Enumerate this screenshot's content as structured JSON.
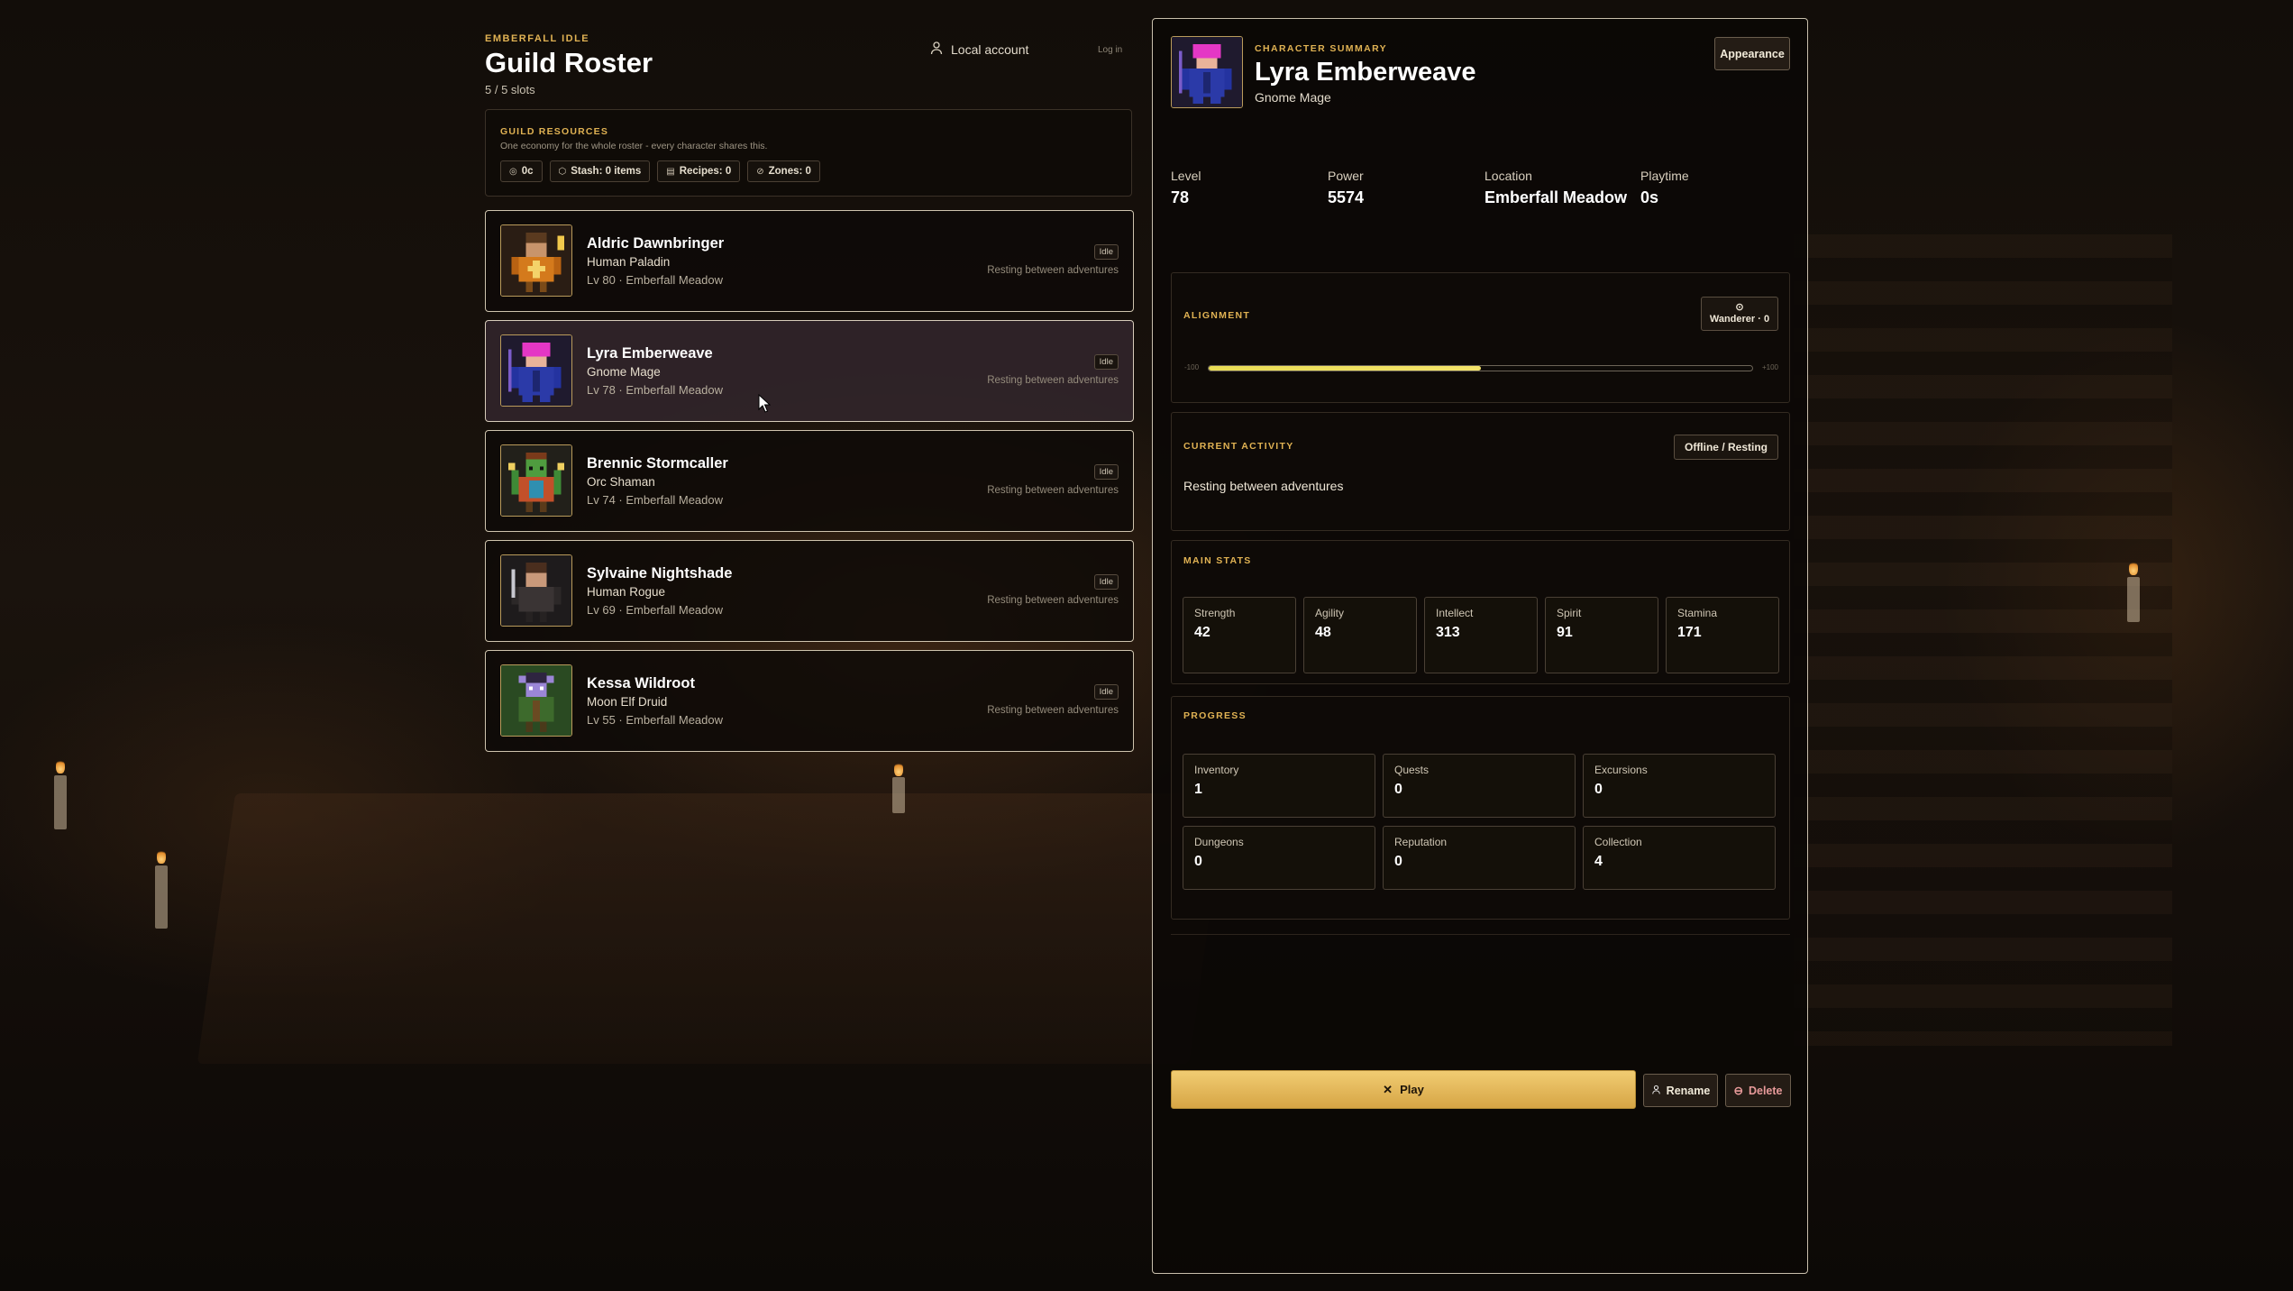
{
  "app": {
    "brand": "EMBERFALL IDLE",
    "title": "Guild Roster",
    "slots": "5 / 5 slots"
  },
  "account": {
    "label": "Local account",
    "login": "Log in"
  },
  "resources": {
    "title": "GUILD RESOURCES",
    "subtitle": "One economy for the whole roster - every character shares this.",
    "chips": [
      {
        "icon": "coin-icon",
        "label": "0c"
      },
      {
        "icon": "box-icon",
        "label": "Stash: 0 items"
      },
      {
        "icon": "scroll-icon",
        "label": "Recipes: 0"
      },
      {
        "icon": "compass-icon",
        "label": "Zones: 0"
      }
    ]
  },
  "roster": [
    {
      "name": "Aldric Dawnbringer",
      "class": "Human Paladin",
      "meta": "Lv 80 · Emberfall Meadow",
      "badge": "Idle",
      "status": "Resting between adventures",
      "selected": false
    },
    {
      "name": "Lyra Emberweave",
      "class": "Gnome Mage",
      "meta": "Lv 78 · Emberfall Meadow",
      "badge": "Idle",
      "status": "Resting between adventures",
      "selected": true
    },
    {
      "name": "Brennic Stormcaller",
      "class": "Orc Shaman",
      "meta": "Lv 74 · Emberfall Meadow",
      "badge": "Idle",
      "status": "Resting between adventures",
      "selected": false
    },
    {
      "name": "Sylvaine Nightshade",
      "class": "Human Rogue",
      "meta": "Lv 69 · Emberfall Meadow",
      "badge": "Idle",
      "status": "Resting between adventures",
      "selected": false
    },
    {
      "name": "Kessa Wildroot",
      "class": "Moon Elf Druid",
      "meta": "Lv 55 · Emberfall Meadow",
      "badge": "Idle",
      "status": "Resting between adventures",
      "selected": false
    }
  ],
  "summary": {
    "eyebrow": "CHARACTER SUMMARY",
    "name": "Lyra Emberweave",
    "class": "Gnome Mage",
    "appearance_label": "Appearance",
    "overview": [
      {
        "label": "Level",
        "value": "78"
      },
      {
        "label": "Power",
        "value": "5574"
      },
      {
        "label": "Location",
        "value": "Emberfall Meadow"
      },
      {
        "label": "Playtime",
        "value": "0s"
      }
    ],
    "alignment": {
      "title": "ALIGNMENT",
      "badge_icon": "compass-icon",
      "badge": "Wanderer · 0",
      "min": "-100",
      "max": "+100",
      "value": 0,
      "fill_fraction": 0.5
    },
    "activity": {
      "title": "CURRENT ACTIVITY",
      "badge": "Offline / Resting",
      "text": "Resting between adventures"
    },
    "main_stats": {
      "title": "MAIN STATS",
      "items": [
        {
          "label": "Strength",
          "value": "42"
        },
        {
          "label": "Agility",
          "value": "48"
        },
        {
          "label": "Intellect",
          "value": "313"
        },
        {
          "label": "Spirit",
          "value": "91"
        },
        {
          "label": "Stamina",
          "value": "171"
        }
      ]
    },
    "progress": {
      "title": "PROGRESS",
      "items": [
        {
          "label": "Inventory",
          "value": "1"
        },
        {
          "label": "Quests",
          "value": "0"
        },
        {
          "label": "Excursions",
          "value": "0"
        },
        {
          "label": "Dungeons",
          "value": "0"
        },
        {
          "label": "Reputation",
          "value": "0"
        },
        {
          "label": "Collection",
          "value": "4"
        }
      ]
    },
    "actions": {
      "play": "Play",
      "rename": "Rename",
      "delete": "Delete"
    }
  },
  "colors": {
    "accent": "#e0b253",
    "play": "#e8bd5c",
    "alignment_fill": "#f0e060",
    "danger": "#e79a9a"
  }
}
